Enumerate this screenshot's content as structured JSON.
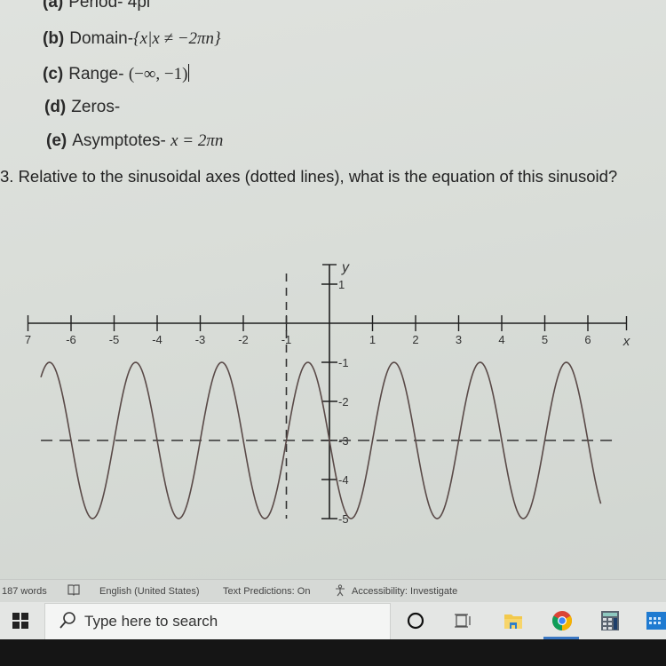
{
  "document": {
    "items": [
      {
        "label": "(a)",
        "text": "Period- 4pi",
        "math": ""
      },
      {
        "label": "(b)",
        "text": "Domain-",
        "math": "{x|x ≠ −2πn}"
      },
      {
        "label": "(c)",
        "text": "Range- ",
        "math": "(−∞, −1)"
      },
      {
        "label": "(d)",
        "text": "Zeros-",
        "math": ""
      },
      {
        "label": "(e)",
        "text": "Asymptotes- ",
        "math": "x = 2πn"
      }
    ],
    "question": "3. Relative to the sinusoidal axes (dotted lines), what is the equation of this sinusoid?"
  },
  "chart_data": {
    "type": "line",
    "title": "",
    "xlabel": "x",
    "ylabel": "y",
    "x_ticks": [
      -7,
      -6,
      -5,
      -4,
      -3,
      -2,
      -1,
      1,
      2,
      3,
      4,
      5,
      6
    ],
    "x_tick_labels": [
      "7",
      "-6",
      "-5",
      "-4",
      "-3",
      "-2",
      "-1",
      "1",
      "2",
      "3",
      "4",
      "5",
      "6"
    ],
    "y_ticks": [
      1,
      -1,
      -2,
      -3,
      -4,
      -5
    ],
    "y_tick_labels": [
      "1",
      "-1",
      "-2",
      "-3",
      "-4",
      "-5"
    ],
    "xlim": [
      -7,
      7
    ],
    "ylim": [
      -5,
      1.5
    ],
    "grid": false,
    "sinusoidal_axes": {
      "vertical_x": -1,
      "horizontal_y": -3,
      "style": "dashed"
    },
    "series": [
      {
        "name": "sinusoid",
        "function": "y = -3 + 2*sin(pi*(x+1))",
        "amplitude": 2,
        "midline": -3,
        "period": 2,
        "phase_shift": -1,
        "x_domain": [
          -6.7,
          6.3
        ],
        "key_points": [
          {
            "x": -6.5,
            "y": -1
          },
          {
            "x": -5.5,
            "y": -5
          },
          {
            "x": -4.5,
            "y": -1
          },
          {
            "x": -3.5,
            "y": -5
          },
          {
            "x": -2.5,
            "y": -1
          },
          {
            "x": -1.5,
            "y": -5
          },
          {
            "x": -0.5,
            "y": -1
          },
          {
            "x": 0.5,
            "y": -5
          },
          {
            "x": 1.5,
            "y": -1
          },
          {
            "x": 2.5,
            "y": -5
          },
          {
            "x": 3.5,
            "y": -1
          },
          {
            "x": 4.5,
            "y": -5
          },
          {
            "x": 5.5,
            "y": -1
          }
        ]
      }
    ]
  },
  "status_bar": {
    "word_count": "187 words",
    "language": "English (United States)",
    "text_predictions": "Text Predictions: On",
    "accessibility": "Accessibility: Investigate"
  },
  "taskbar": {
    "search_placeholder": "Type here to search",
    "icons": [
      "cortana-icon",
      "task-view-icon",
      "file-explorer-icon",
      "chrome-icon",
      "calculator-icon",
      "calendar-icon"
    ]
  }
}
